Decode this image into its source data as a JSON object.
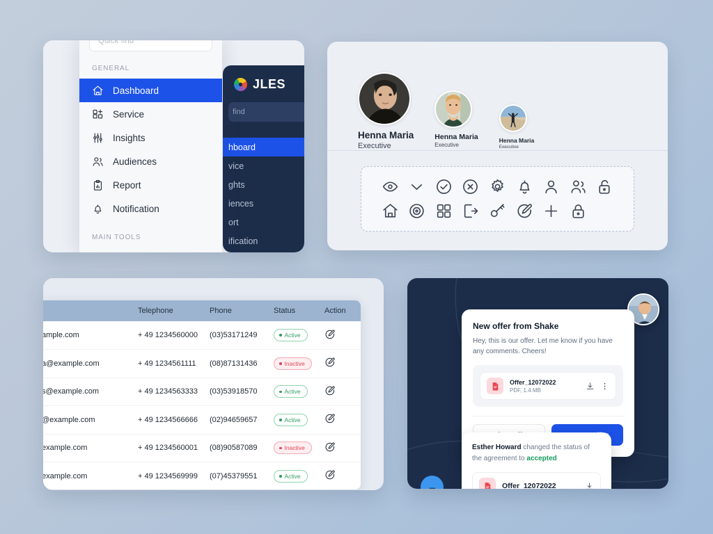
{
  "topleft": {
    "quick_find_placeholder": "Quick find",
    "section_general": "GENERAL",
    "section_main_tools": "MAIN TOOLS",
    "nav": [
      {
        "label": "Dashboard",
        "icon": "home-icon",
        "active": true
      },
      {
        "label": "Service",
        "icon": "grid-plus-icon",
        "active": false
      },
      {
        "label": "Insights",
        "icon": "sliders-icon",
        "active": false
      },
      {
        "label": "Audiences",
        "icon": "users-icon",
        "active": false
      },
      {
        "label": "Report",
        "icon": "clipboard-chart-icon",
        "active": false
      },
      {
        "label": "Notification",
        "icon": "bell-icon",
        "active": false
      }
    ],
    "dark": {
      "brand": "JLES",
      "search_placeholder": "find",
      "items": [
        {
          "label": "hboard",
          "active": true
        },
        {
          "label": "vice",
          "active": false
        },
        {
          "label": "ghts",
          "active": false
        },
        {
          "label": "iences",
          "active": false
        },
        {
          "label": "ort",
          "active": false
        },
        {
          "label": "ification",
          "active": false
        }
      ]
    },
    "accent": "#1d52e8"
  },
  "topright": {
    "people": [
      {
        "name": "Henna Maria",
        "role": "Executive",
        "size": "lg"
      },
      {
        "name": "Henna Maria",
        "role": "Executive",
        "size": "md"
      },
      {
        "name": "Henna Maria",
        "role": "Executive",
        "size": "sm"
      }
    ],
    "icons": [
      "eye-icon",
      "chevron-down-icon",
      "check-circle-icon",
      "x-circle-icon",
      "gear-icon",
      "bell-icon",
      "user-icon",
      "users-icon",
      "unlock-icon",
      "home-icon",
      "record-icon",
      "grid-icon",
      "logout-icon",
      "key-icon",
      "edit-icon",
      "plus-icon",
      "lock-icon"
    ]
  },
  "table": {
    "columns": [
      "",
      "Telephone",
      "Phone",
      "Status",
      "Action"
    ],
    "rows": [
      {
        "email": "ample.com",
        "telephone": "+ 49 1234560000",
        "phone": "(03)53171249",
        "status": "Active"
      },
      {
        "email": "a@example.com",
        "telephone": "+ 49 1234561111",
        "phone": "(08)87131436",
        "status": "Inactive"
      },
      {
        "email": "s@example.com",
        "telephone": "+ 49 1234563333",
        "phone": "(03)53918570",
        "status": "Active"
      },
      {
        "email": "@example.com",
        "telephone": "+ 49 1234566666",
        "phone": "(02)94659657",
        "status": "Active"
      },
      {
        "email": "example.com",
        "telephone": "+ 49 1234560001",
        "phone": "(08)90587089",
        "status": "Inactive"
      },
      {
        "email": "example.com",
        "telephone": "+ 49 1234569999",
        "phone": "(07)45379551",
        "status": "Active"
      }
    ],
    "header_color": "#9cb4d0",
    "active_color": "#2f9e63",
    "inactive_color": "#e0465c"
  },
  "chat": {
    "offer": {
      "title": "New offer from Shake",
      "body": "Hey, this is our offer. Let me know if you have any comments. Cheers!",
      "file_name": "Offer_12072022",
      "file_meta": "PDF, 1.4 MB",
      "reject_label": "Reject offer",
      "accept_label": "Accept offer"
    },
    "status": {
      "actor": "Esther Howard",
      "text_1": " changed the status of the agreement to ",
      "state": "accepted",
      "file_name": "Offer_12072022"
    },
    "accent": "#1d52e8",
    "bg": "#1c2d4a"
  }
}
